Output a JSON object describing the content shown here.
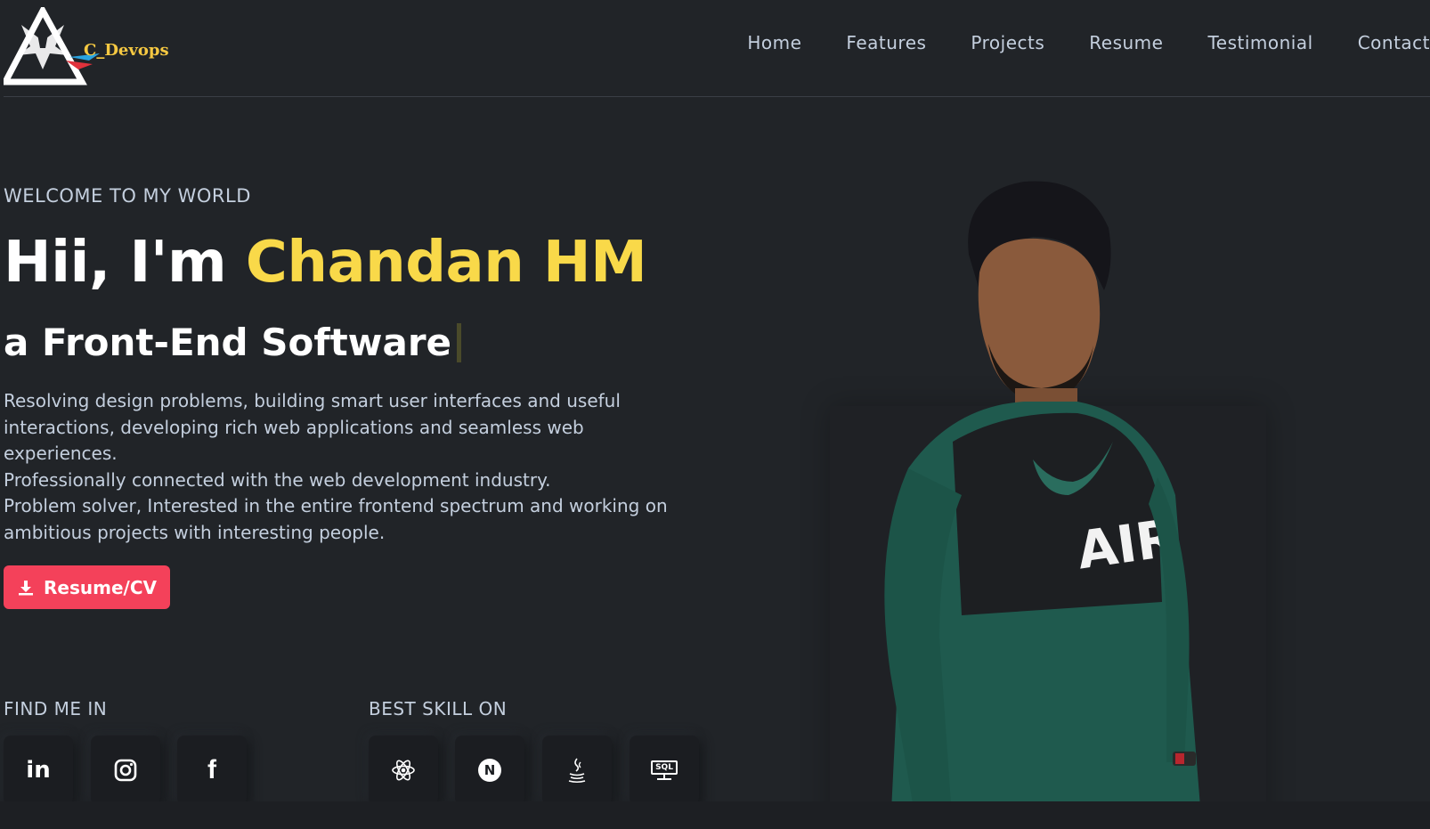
{
  "brand": {
    "logo_text": "C_Devops"
  },
  "nav": {
    "items": [
      {
        "label": "Home"
      },
      {
        "label": "Features"
      },
      {
        "label": "Projects"
      },
      {
        "label": "Resume"
      },
      {
        "label": "Testimonial"
      },
      {
        "label": "Contact"
      }
    ]
  },
  "hero": {
    "welcome": "WELCOME TO MY WORLD",
    "greeting": "Hii, I'm ",
    "name": "Chandan HM",
    "role": "a Front-End Software",
    "description_lines": [
      "Resolving design problems, building smart user interfaces and useful",
      "interactions, developing rich web applications and seamless web",
      "experiences.",
      "Professionally connected with the web development industry.",
      "Problem solver, Interested in the entire frontend spectrum and working on",
      "ambitious projects with interesting people."
    ],
    "resume_button": "Resume/CV"
  },
  "find_me": {
    "label": "FIND ME IN",
    "links": [
      {
        "icon": "linkedin-icon",
        "text": "in"
      },
      {
        "icon": "instagram-icon"
      },
      {
        "icon": "facebook-icon",
        "text": "f"
      }
    ]
  },
  "skills": {
    "label": "BEST SKILL ON",
    "items": [
      {
        "icon": "react-icon"
      },
      {
        "icon": "nextjs-icon",
        "text": "N"
      },
      {
        "icon": "java-icon"
      },
      {
        "icon": "sql-icon",
        "text": "SQL"
      }
    ]
  },
  "colors": {
    "background": "#212428",
    "accent_name": "#f9d949",
    "button": "#f4415a",
    "text": "#c4cfde"
  }
}
